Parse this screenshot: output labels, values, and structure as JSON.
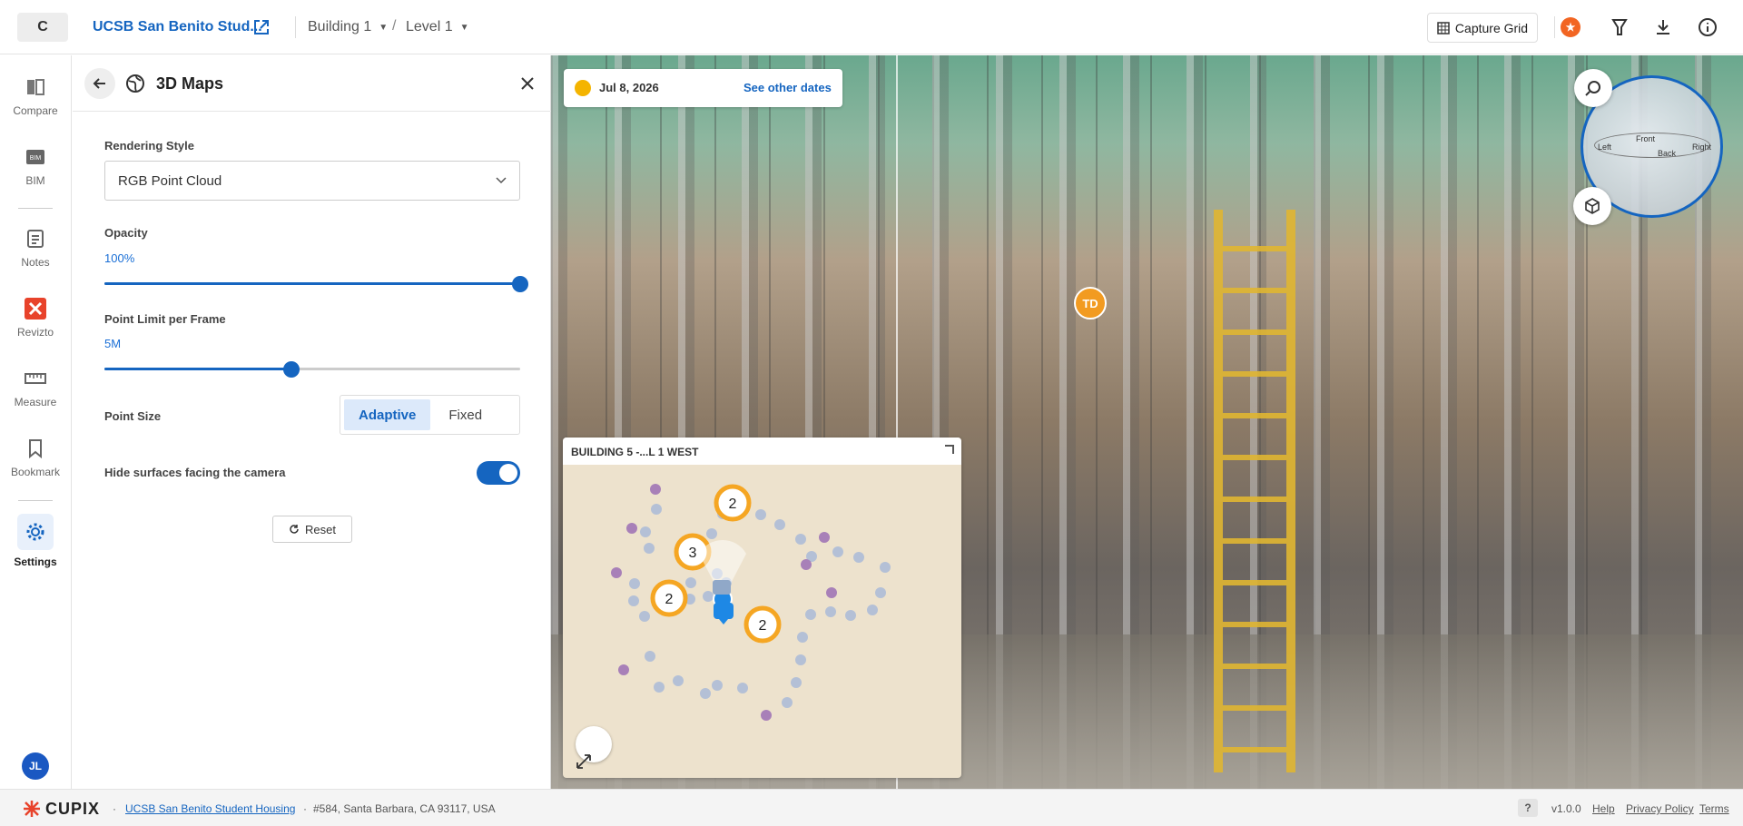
{
  "topbar": {
    "project_initial": "C",
    "project_title": "UCSB San Benito Stud...",
    "building": "Building 1",
    "level": "Level 1",
    "separator": "/",
    "capture_grid_label": "Capture Grid"
  },
  "leftnav": {
    "items": [
      {
        "label": "Compare",
        "icon": "compare-icon"
      },
      {
        "label": "BIM",
        "icon": "bim-icon"
      },
      {
        "label": "Notes",
        "icon": "notes-icon"
      },
      {
        "label": "Revizto",
        "icon": "revizto-icon"
      },
      {
        "label": "Measure",
        "icon": "measure-icon"
      },
      {
        "label": "Bookmark",
        "icon": "bookmark-icon"
      },
      {
        "label": "Settings",
        "icon": "gear-icon"
      }
    ],
    "user_initials": "JL",
    "active": "Settings"
  },
  "panel": {
    "title": "3D Maps",
    "rendering_style_label": "Rendering Style",
    "rendering_style_value": "RGB Point Cloud",
    "opacity_label": "Opacity",
    "opacity_value": "100%",
    "opacity_fraction": 1.0,
    "point_limit_label": "Point Limit per Frame",
    "point_limit_value": "5M",
    "point_limit_fraction": 0.45,
    "point_size_label": "Point Size",
    "point_size_options": [
      "Adaptive",
      "Fixed"
    ],
    "point_size_selected": "Adaptive",
    "hide_surfaces_label": "Hide surfaces facing the camera",
    "hide_surfaces_on": true,
    "reset_label": "Reset"
  },
  "viewer": {
    "date": "Jul 8, 2026",
    "other_dates_link": "See other dates",
    "marker_initials": "TD",
    "compass": {
      "front": "Front",
      "back": "Back",
      "left": "Left",
      "right": "Right"
    },
    "minimap": {
      "title": "BUILDING 5 -...L 1 WEST",
      "clusters": [
        "2",
        "3",
        "2",
        "2"
      ]
    }
  },
  "footer": {
    "brand": "CUPIX",
    "project_link": "UCSB San Benito Student Housing",
    "address": "#584, Santa Barbara, CA 93117, USA",
    "help_glyph": "?",
    "version": "v1.0.0",
    "help": "Help",
    "privacy": "Privacy Policy",
    "terms": "Terms",
    "bullet": "·"
  },
  "colors": {
    "accent": "#1565c0",
    "marker": "#f29b21",
    "brand_red": "#e8432b"
  }
}
